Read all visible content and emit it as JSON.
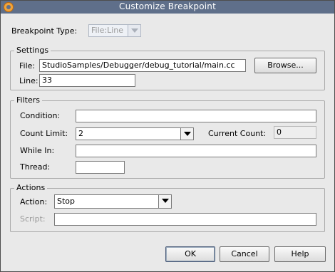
{
  "window": {
    "title": "Customize Breakpoint"
  },
  "breakpoint_type": {
    "label": "Breakpoint Type:",
    "value": "File:Line"
  },
  "settings": {
    "group_label": "Settings",
    "file_label": "File:",
    "file_value": "StudioSamples/Debugger/debug_tutorial/main.cc",
    "browse_label": "Browse...",
    "line_label": "Line:",
    "line_value": "33"
  },
  "filters": {
    "group_label": "Filters",
    "condition_label": "Condition:",
    "condition_value": "",
    "count_limit_label": "Count Limit:",
    "count_limit_value": "2",
    "current_count_label": "Current Count:",
    "current_count_value": "0",
    "while_in_label": "While In:",
    "while_in_value": "",
    "thread_label": "Thread:",
    "thread_value": ""
  },
  "actions": {
    "group_label": "Actions",
    "action_label": "Action:",
    "action_value": "Stop",
    "script_label": "Script:",
    "script_value": ""
  },
  "buttons": {
    "ok": "OK",
    "cancel": "Cancel",
    "help": "Help"
  },
  "colors": {
    "titlebar": "#5f6f8a",
    "dialog_bg": "#e9e9e9"
  }
}
